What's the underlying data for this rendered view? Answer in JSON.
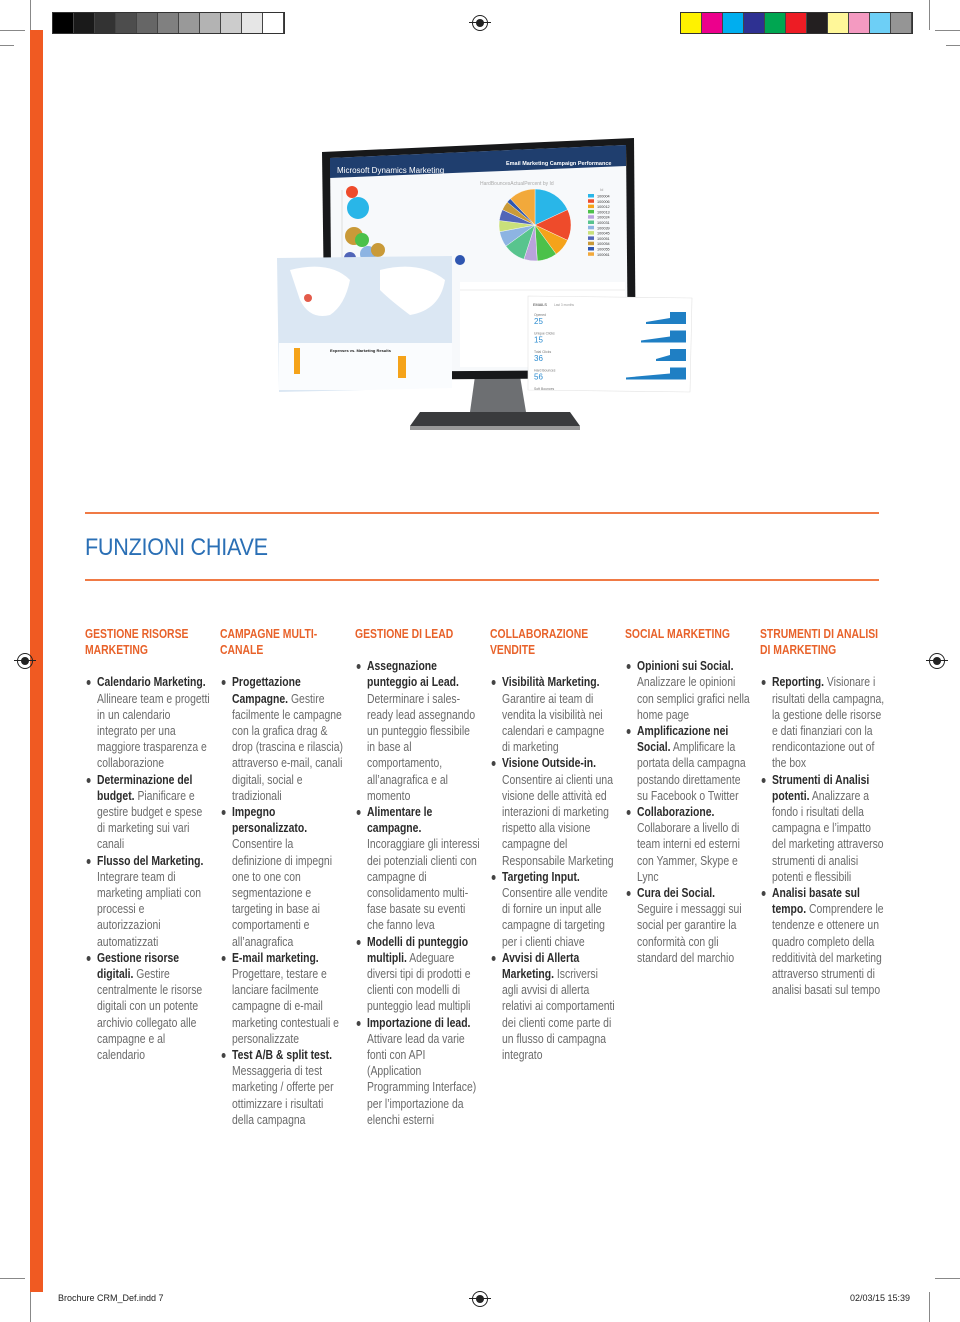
{
  "print_marks": {
    "gray_swatches": [
      "#000000",
      "#1a1a1a",
      "#333333",
      "#4d4d4d",
      "#666666",
      "#808080",
      "#999999",
      "#b3b3b3",
      "#cccccc",
      "#e6e6e6",
      "#ffffff"
    ],
    "color_swatches": [
      "#fff200",
      "#ec008c",
      "#00aeef",
      "#2e3192",
      "#00a651",
      "#ed1c24",
      "#231f20",
      "#fff799",
      "#f49ac1",
      "#6dcff6",
      "#959595"
    ],
    "footer_left": "Brochure CRM_Def.indd   7",
    "footer_right": "02/03/15   15:39"
  },
  "accent_color": "#f05a22",
  "title_color": "#2a6fb5",
  "hero": {
    "app_title": "Microsoft Dynamics Marketing",
    "dashboard_title": "Email Marketing Campaign Performance",
    "pie_title": "HardBouncesActualPercent by Id",
    "legend_title": "Id",
    "legend": [
      {
        "id": "100004",
        "color": "#29b6e8",
        "share": 0.18
      },
      {
        "id": "100006",
        "color": "#ee4b2b",
        "share": 0.14
      },
      {
        "id": "100012",
        "color": "#f5a31a",
        "share": 0.08
      },
      {
        "id": "100013",
        "color": "#4cc14a",
        "share": 0.09
      },
      {
        "id": "100024",
        "color": "#b9a3dc",
        "share": 0.06
      },
      {
        "id": "100031",
        "color": "#58c48e",
        "share": 0.1
      },
      {
        "id": "100039",
        "color": "#8db4e2",
        "share": 0.07
      },
      {
        "id": "100045",
        "color": "#c9e07a",
        "share": 0.05
      },
      {
        "id": "100051",
        "color": "#5165b8",
        "share": 0.05
      },
      {
        "id": "100054",
        "color": "#c99a38",
        "share": 0.04
      },
      {
        "id": "100055",
        "color": "#2f56b0",
        "share": 0.02
      },
      {
        "id": "100061",
        "color": "#f2a93b",
        "share": 0.12
      }
    ],
    "map_chart_title": "Expenses vs. Marketing Results",
    "emails_panel": {
      "header": "EMAILS",
      "range": "Last 3 months",
      "metrics": [
        {
          "label": "Opened",
          "value": "25"
        },
        {
          "label": "Unique Clicks",
          "value": "15"
        },
        {
          "label": "Total Clicks",
          "value": "36"
        },
        {
          "label": "Hard Bounces",
          "value": "56"
        },
        {
          "label": "Soft Bounces",
          "value": ""
        }
      ]
    }
  },
  "section_title": "FUNZIONI CHIAVE",
  "columns": [
    {
      "heading": "GESTIONE RISORSE MARKETING",
      "items": [
        {
          "bold": "Calendario Marketing.",
          "text": " Allineare team e progetti in un calendario integrato per una maggiore trasparenza e collaborazione"
        },
        {
          "bold": "Determinazione del budget.",
          "text": " Pianificare e gestire budget e spese di marketing sui vari canali"
        },
        {
          "bold": "Flusso del Marketing.",
          "text": " Integrare team di marketing ampliati con processi e autorizzazioni automatizzati"
        },
        {
          "bold": "Gestione risorse digitali.",
          "text": " Gestire centralmente le risorse digitali con un potente archivio collegato alle campagne e al calendario"
        }
      ]
    },
    {
      "heading": "CAMPAGNE MULTI-CANALE",
      "items": [
        {
          "bold": "Progettazione Campagne.",
          "text": " Gestire facilmente le campagne con la grafica drag & drop (trascina e rilascia) attraverso e-mail, canali digitali, social e tradizionali"
        },
        {
          "bold": "Impegno personalizzato.",
          "text": " Consentire la definizione di impegni one to one con segmentazione e targeting in base ai comportamenti e all’anagrafica"
        },
        {
          "bold": "E-mail marketing.",
          "text": " Progettare, testare e lanciare facilmente campagne di e-mail marketing contestuali e personalizzate"
        },
        {
          "bold": "Test A/B & split test.",
          "text": " Messaggeria di test marketing / offerte per ottimizzare i risultati della campagna"
        }
      ]
    },
    {
      "heading": "GESTIONE DI LEAD",
      "items": [
        {
          "bold": "Assegnazione punteggio ai Lead.",
          "text": " Determinare i sales-ready lead assegnando un punteggio flessibile in base al comportamento, all’anagrafica e al momento"
        },
        {
          "bold": "Alimentare le campagne.",
          "text": " Incoraggiare gli interessi dei potenziali clienti con campagne di consolidamento multi-fase basate su eventi che fanno leva"
        },
        {
          "bold": "Modelli di punteggio multipli.",
          "text": " Adeguare diversi tipi di prodotti e clienti con modelli di punteggio lead multipli"
        },
        {
          "bold": "Importazione di lead.",
          "text": " Attivare lead da varie fonti con API (Application Programming Interface) per l’importazione da elenchi esterni"
        }
      ]
    },
    {
      "heading": "COLLABORAZIONE VENDITE",
      "items": [
        {
          "bold": "Visibilità Marketing.",
          "text": " Garantire ai team di vendita la visibilità nei calendari e campagne di marketing"
        },
        {
          "bold": "Visione Outside-in.",
          "text": " Consentire ai clienti una visione delle attività ed interazioni di marketing rispetto alla visione campagne del Responsabile Marketing"
        },
        {
          "bold": "Targeting Input.",
          "text": " Consentire alle vendite di fornire un input alle campagne di targeting per i clienti chiave"
        },
        {
          "bold": "Avvisi di Allerta Marketing.",
          "text": " Iscriversi agli avvisi di allerta relativi ai comportamenti dei clienti come parte di un flusso di campagna integrato"
        }
      ]
    },
    {
      "heading": "SOCIAL MARKETING",
      "items": [
        {
          "bold": "Opinioni sui Social.",
          "text": " Analizzare le opinioni con semplici grafici nella home page"
        },
        {
          "bold": "Amplificazione nei Social.",
          "text": " Amplificare la portata della campagna postando direttamente su Facebook o Twitter"
        },
        {
          "bold": "Collaborazione.",
          "text": " Collaborare a livello di team interni ed esterni con Yammer, Skype e Lync"
        },
        {
          "bold": "Cura dei Social.",
          "text": " Seguire i messaggi sui social per garantire la conformità con gli standard del marchio"
        }
      ]
    },
    {
      "heading": "STRUMENTI DI ANALISI DI MARKETING",
      "items": [
        {
          "bold": "Reporting.",
          "text": " Visionare i risultati della campagna, la gestione delle risorse e dati finanziari con la rendicontazione out of the box"
        },
        {
          "bold": "Strumenti di Analisi potenti.",
          "text": " Analizzare a fondo i risultati della campagna e l’impatto del marketing attraverso strumenti di analisi potenti e flessibili"
        },
        {
          "bold": "Analisi basate sul tempo.",
          "text": " Comprendere le tendenze e ottenere un quadro completo della redditività del marketing attraverso strumenti di analisi basati sul tempo"
        }
      ]
    }
  ]
}
